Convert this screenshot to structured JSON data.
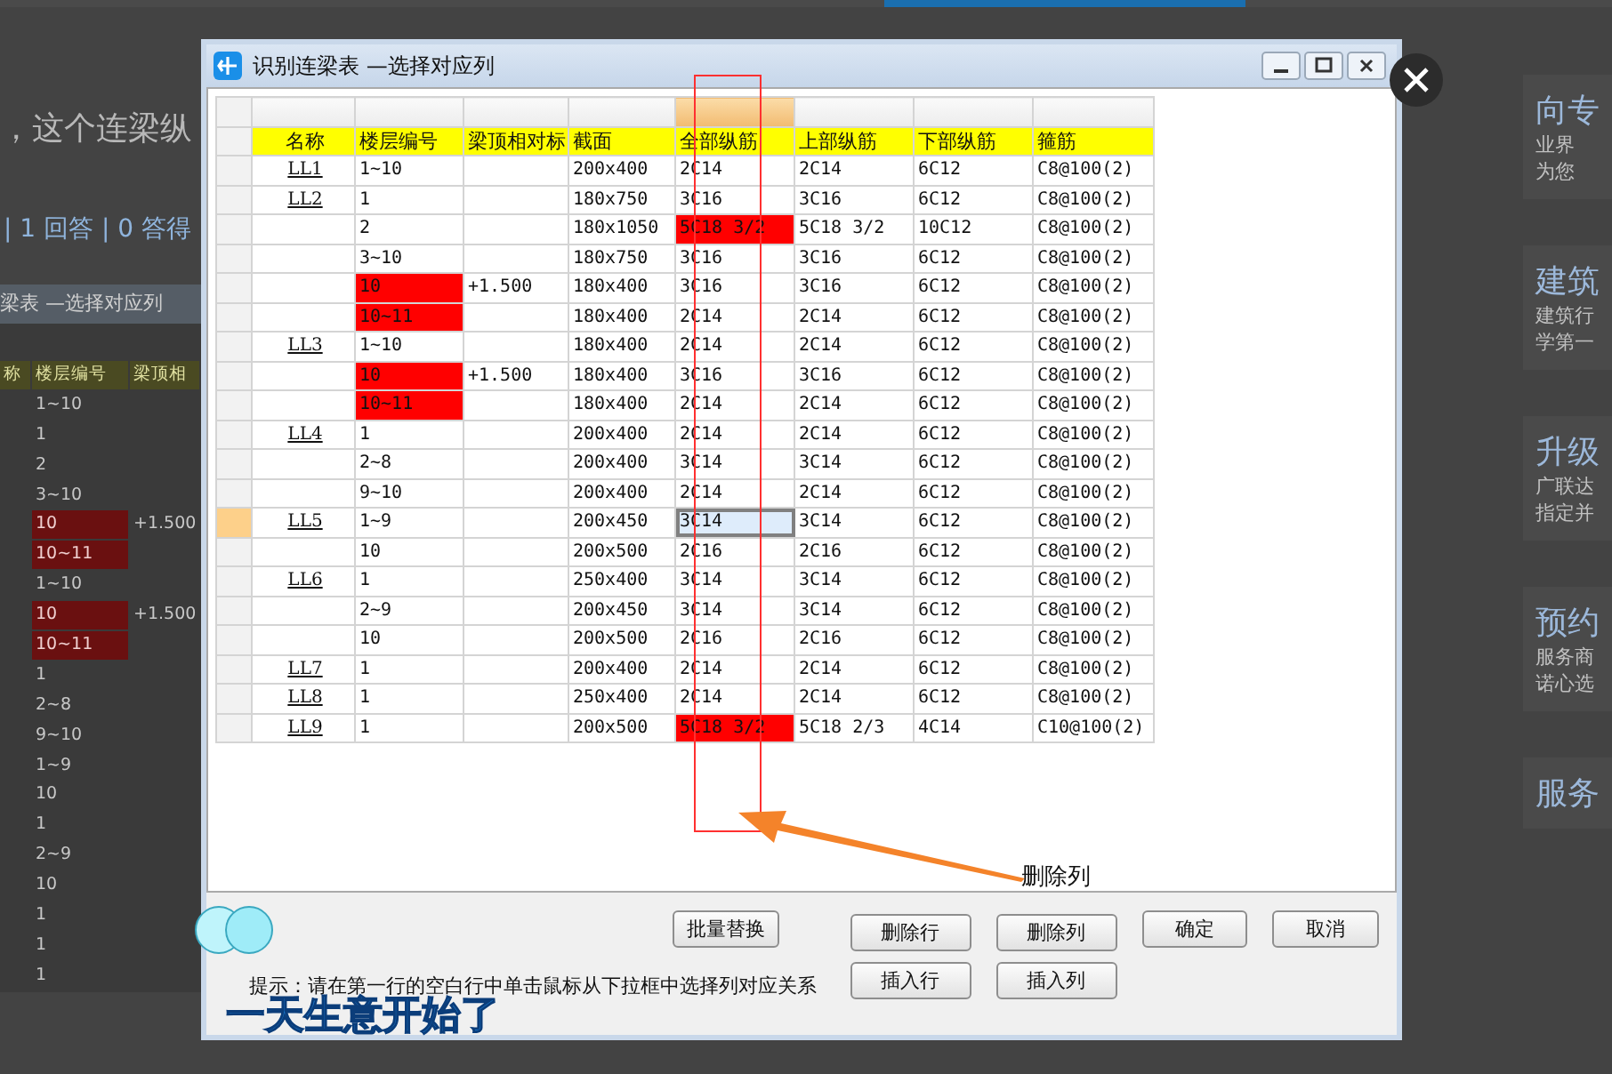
{
  "background_page": {
    "question_title": "，这个连梁纵",
    "stats": "| 1 回答 | 0 答得",
    "dialog_title": "梁表 —选择对应列",
    "table_header": [
      "称",
      "楼层编号",
      "梁顶相"
    ],
    "table_rows": [
      {
        "floor": "1~10",
        "flagged": false
      },
      {
        "floor": "1",
        "flagged": false
      },
      {
        "floor": "2",
        "flagged": false
      },
      {
        "floor": "3~10",
        "flagged": false
      },
      {
        "floor": "10",
        "elevation": "+1.500",
        "flagged": true
      },
      {
        "floor": "10~11",
        "flagged": true
      },
      {
        "floor": "1~10",
        "flagged": false
      },
      {
        "floor": "10",
        "elevation": "+1.500",
        "flagged": true
      },
      {
        "floor": "10~11",
        "flagged": true
      },
      {
        "floor": "1",
        "flagged": false
      },
      {
        "floor": "2~8",
        "flagged": false
      },
      {
        "floor": "9~10",
        "flagged": false
      },
      {
        "floor": "1~9",
        "flagged": false
      },
      {
        "floor": "10",
        "flagged": false
      },
      {
        "floor": "1",
        "flagged": false
      },
      {
        "floor": "2~9",
        "flagged": false
      },
      {
        "floor": "10",
        "flagged": false
      },
      {
        "floor": "1",
        "flagged": false
      },
      {
        "floor": "1",
        "flagged": false
      },
      {
        "floor": "1",
        "flagged": false
      }
    ],
    "side_cards": [
      {
        "title": "向专",
        "lines": [
          "业界",
          "为您"
        ]
      },
      {
        "title": "建筑",
        "lines": [
          "建筑行",
          "学第一"
        ]
      },
      {
        "title": "升级",
        "lines": [
          "广联达",
          "指定并"
        ]
      },
      {
        "title": "预约",
        "lines": [
          "服务商",
          "诺心选"
        ]
      },
      {
        "title": "服务"
      }
    ]
  },
  "dialog": {
    "title": "识别连梁表 —选择对应列",
    "columns": [
      {
        "label": "名称",
        "selected": false
      },
      {
        "label": "楼层编号",
        "selected": false
      },
      {
        "label": "梁顶相对标",
        "selected": false
      },
      {
        "label": "截面",
        "selected": false
      },
      {
        "label": "全部纵筋",
        "selected": true
      },
      {
        "label": "上部纵筋",
        "selected": false
      },
      {
        "label": "下部纵筋",
        "selected": false
      },
      {
        "label": "箍筋",
        "selected": false
      }
    ],
    "rows": [
      {
        "name": "LL1",
        "floor": "1~10",
        "section": "200x400",
        "all_bars": "2C14",
        "top_bars": "2C14",
        "bottom_bars": "6C12",
        "stirrup": "C8@100(2)",
        "floor_flagged": false,
        "bars_flagged": false,
        "selected": false
      },
      {
        "name": "LL2",
        "floor": "1",
        "section": "180x750",
        "all_bars": "3C16",
        "top_bars": "3C16",
        "bottom_bars": "6C12",
        "stirrup": "C8@100(2)",
        "floor_flagged": false,
        "bars_flagged": false,
        "selected": false
      },
      {
        "floor": "2",
        "section": "180x1050",
        "all_bars": "5C18 3/2",
        "top_bars": "5C18 3/2",
        "bottom_bars": "10C12",
        "stirrup": "C8@100(2)",
        "floor_flagged": false,
        "bars_flagged": true,
        "selected": false
      },
      {
        "floor": "3~10",
        "section": "180x750",
        "all_bars": "3C16",
        "top_bars": "3C16",
        "bottom_bars": "6C12",
        "stirrup": "C8@100(2)",
        "floor_flagged": false,
        "bars_flagged": false,
        "selected": false
      },
      {
        "floor": "10",
        "elevation": "+1.500",
        "section": "180x400",
        "all_bars": "3C16",
        "top_bars": "3C16",
        "bottom_bars": "6C12",
        "stirrup": "C8@100(2)",
        "floor_flagged": true,
        "bars_flagged": false,
        "selected": false
      },
      {
        "floor": "10~11",
        "section": "180x400",
        "all_bars": "2C14",
        "top_bars": "2C14",
        "bottom_bars": "6C12",
        "stirrup": "C8@100(2)",
        "floor_flagged": true,
        "bars_flagged": false,
        "selected": false
      },
      {
        "name": "LL3",
        "floor": "1~10",
        "section": "180x400",
        "all_bars": "2C14",
        "top_bars": "2C14",
        "bottom_bars": "6C12",
        "stirrup": "C8@100(2)",
        "floor_flagged": false,
        "bars_flagged": false,
        "selected": false
      },
      {
        "floor": "10",
        "elevation": "+1.500",
        "section": "180x400",
        "all_bars": "3C16",
        "top_bars": "3C16",
        "bottom_bars": "6C12",
        "stirrup": "C8@100(2)",
        "floor_flagged": true,
        "bars_flagged": false,
        "selected": false
      },
      {
        "floor": "10~11",
        "section": "180x400",
        "all_bars": "2C14",
        "top_bars": "2C14",
        "bottom_bars": "6C12",
        "stirrup": "C8@100(2)",
        "floor_flagged": true,
        "bars_flagged": false,
        "selected": false
      },
      {
        "name": "LL4",
        "floor": "1",
        "section": "200x400",
        "all_bars": "2C14",
        "top_bars": "2C14",
        "bottom_bars": "6C12",
        "stirrup": "C8@100(2)",
        "floor_flagged": false,
        "bars_flagged": false,
        "selected": false
      },
      {
        "floor": "2~8",
        "section": "200x400",
        "all_bars": "3C14",
        "top_bars": "3C14",
        "bottom_bars": "6C12",
        "stirrup": "C8@100(2)",
        "floor_flagged": false,
        "bars_flagged": false,
        "selected": false
      },
      {
        "floor": "9~10",
        "section": "200x400",
        "all_bars": "2C14",
        "top_bars": "2C14",
        "bottom_bars": "6C12",
        "stirrup": "C8@100(2)",
        "floor_flagged": false,
        "bars_flagged": false,
        "selected": false
      },
      {
        "name": "LL5",
        "floor": "1~9",
        "section": "200x450",
        "all_bars": "3C14",
        "top_bars": "3C14",
        "bottom_bars": "6C12",
        "stirrup": "C8@100(2)",
        "floor_flagged": false,
        "bars_flagged": false,
        "selected": true
      },
      {
        "floor": "10",
        "section": "200x500",
        "all_bars": "2C16",
        "top_bars": "2C16",
        "bottom_bars": "6C12",
        "stirrup": "C8@100(2)",
        "floor_flagged": false,
        "bars_flagged": false,
        "selected": false
      },
      {
        "name": "LL6",
        "floor": "1",
        "section": "250x400",
        "all_bars": "3C14",
        "top_bars": "3C14",
        "bottom_bars": "6C12",
        "stirrup": "C8@100(2)",
        "floor_flagged": false,
        "bars_flagged": false,
        "selected": false
      },
      {
        "floor": "2~9",
        "section": "200x450",
        "all_bars": "3C14",
        "top_bars": "3C14",
        "bottom_bars": "6C12",
        "stirrup": "C8@100(2)",
        "floor_flagged": false,
        "bars_flagged": false,
        "selected": false
      },
      {
        "floor": "10",
        "section": "200x500",
        "all_bars": "2C16",
        "top_bars": "2C16",
        "bottom_bars": "6C12",
        "stirrup": "C8@100(2)",
        "floor_flagged": false,
        "bars_flagged": false,
        "selected": false
      },
      {
        "name": "LL7",
        "floor": "1",
        "section": "200x400",
        "all_bars": "2C14",
        "top_bars": "2C14",
        "bottom_bars": "6C12",
        "stirrup": "C8@100(2)",
        "floor_flagged": false,
        "bars_flagged": false,
        "selected": false
      },
      {
        "name": "LL8",
        "floor": "1",
        "section": "250x400",
        "all_bars": "2C14",
        "top_bars": "2C14",
        "bottom_bars": "6C12",
        "stirrup": "C8@100(2)",
        "floor_flagged": false,
        "bars_flagged": false,
        "selected": false
      },
      {
        "name": "LL9",
        "floor": "1",
        "section": "200x500",
        "all_bars": "5C18 3/2",
        "top_bars": "5C18 2/3",
        "bottom_bars": "4C14",
        "stirrup": "C10@100(2)",
        "floor_flagged": false,
        "bars_flagged": true,
        "selected": false
      }
    ],
    "batch_button": "批量替换",
    "edit_buttons": [
      [
        "删除行",
        "删除列"
      ],
      [
        "插入行",
        "插入列"
      ]
    ],
    "confirm_button": "确定",
    "cancel_button": "取消",
    "hint": "提示：请在第一行的空白行中单击鼠标从下拉框中选择列对应关系"
  },
  "annotation": {
    "label": "删除列"
  },
  "video_caption": "一天生意开始了"
}
